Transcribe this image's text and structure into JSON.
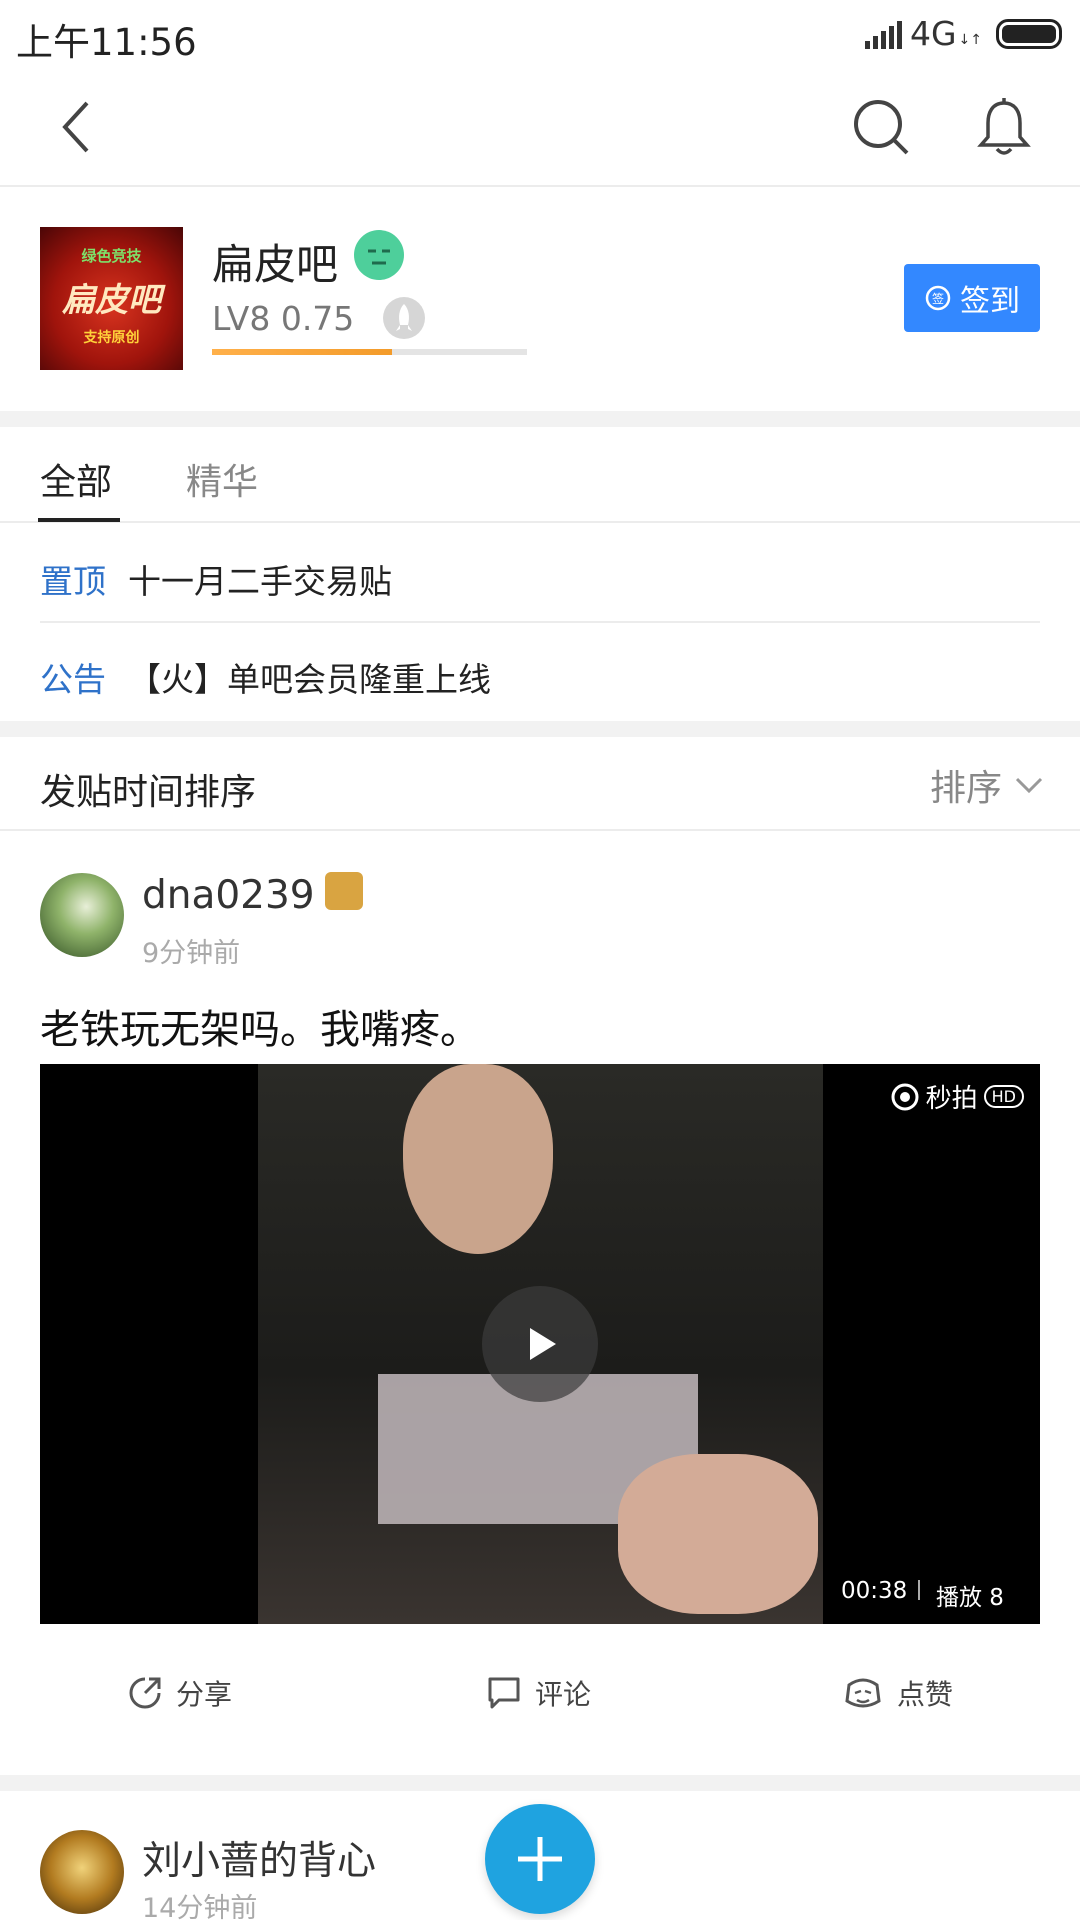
{
  "status_bar": {
    "time": "上午11:56",
    "network": "4G"
  },
  "nav": {
    "back_icon": "chevron-left-icon",
    "search_icon": "search-icon",
    "bell_icon": "bell-icon"
  },
  "forum": {
    "logo_text_top": "绿色竞技",
    "logo_text_main": "扁皮吧",
    "logo_text_bottom": "支持原创",
    "name": "扁皮吧",
    "level": "LV8 0.75",
    "level_progress": 0.57,
    "sign_in_label": "签到",
    "accent_color": "#3388ff"
  },
  "tabs": [
    {
      "label": "全部",
      "active": true
    },
    {
      "label": "精华",
      "active": false
    }
  ],
  "pinned": [
    {
      "tag": "置顶",
      "text": "十一月二手交易贴"
    },
    {
      "tag": "公告",
      "text": "【火】单吧会员隆重上线"
    }
  ],
  "sort": {
    "label": "发贴时间排序",
    "button": "排序"
  },
  "posts": [
    {
      "author": "dna0239",
      "time": "9分钟前",
      "title": "老铁玩无架吗。我嘴疼。",
      "video": {
        "logo": "秒拍",
        "hd": "HD",
        "duration": "00:38",
        "plays": "播放 8"
      },
      "actions": {
        "share": "分享",
        "comment": "评论",
        "like": "点赞"
      }
    },
    {
      "author": "刘小蔷的背心",
      "time": "14分钟前"
    }
  ]
}
